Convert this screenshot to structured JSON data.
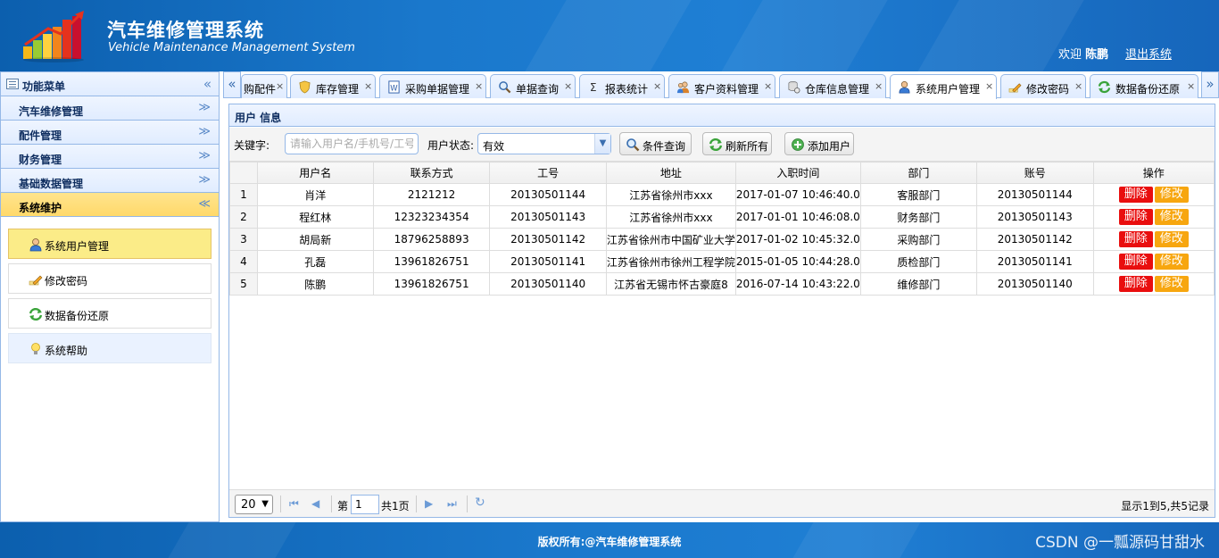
{
  "header": {
    "title": "汽车维修管理系统",
    "subtitle": "Vehicle Maintenance Management System",
    "welcome_prefix": "欢迎",
    "user_name": "陈鹏",
    "logout": "退出系统"
  },
  "sidebar": {
    "title": "功能菜单",
    "collapse_glyph": "«",
    "sections": [
      {
        "label": "汽车维修管理",
        "glyph": "≫"
      },
      {
        "label": "配件管理",
        "glyph": "≫"
      },
      {
        "label": "财务管理",
        "glyph": "≫"
      },
      {
        "label": "基础数据管理",
        "glyph": "≫"
      },
      {
        "label": "系统维护",
        "glyph": "≪"
      }
    ],
    "sub_items": [
      {
        "label": "系统用户管理",
        "icon": "user-icon"
      },
      {
        "label": "修改密码",
        "icon": "pencil-icon"
      },
      {
        "label": "数据备份还原",
        "icon": "refresh-icon"
      },
      {
        "label": "系统帮助",
        "icon": "lightbulb-icon"
      }
    ]
  },
  "tabs": {
    "scroll_left": "«",
    "scroll_right": "»",
    "close_glyph": "×",
    "items": [
      {
        "label": "购配件",
        "icon": "none"
      },
      {
        "label": "库存管理",
        "icon": "shield-icon"
      },
      {
        "label": "采购单据管理",
        "icon": "document-icon"
      },
      {
        "label": "单据查询",
        "icon": "search-icon"
      },
      {
        "label": "报表统计",
        "icon": "sigma-icon"
      },
      {
        "label": "客户资料管理",
        "icon": "users-icon"
      },
      {
        "label": "仓库信息管理",
        "icon": "database-icon"
      },
      {
        "label": "系统用户管理",
        "icon": "user-icon"
      },
      {
        "label": "修改密码",
        "icon": "pencil-icon"
      },
      {
        "label": "数据备份还原",
        "icon": "refresh-icon"
      }
    ]
  },
  "panel": {
    "title": "用户 信息",
    "keyword_label": "关键字:",
    "keyword_placeholder": "请输入用户名/手机号/工号",
    "status_label": "用户状态:",
    "status_value": "有效",
    "btn_query": "条件查询",
    "btn_refresh": "刷新所有",
    "btn_add": "添加用户"
  },
  "grid": {
    "columns": [
      "用户名",
      "联系方式",
      "工号",
      "地址",
      "入职时间",
      "部门",
      "账号",
      "操作"
    ],
    "delete_label": "删除",
    "edit_label": "修改",
    "rows": [
      {
        "n": "1",
        "name": "肖洋",
        "phone": "2121212",
        "no": "20130501144",
        "addr": "江苏省徐州市xxx",
        "time": "2017-01-07 10:46:40.0",
        "dept": "客服部门",
        "acct": "20130501144"
      },
      {
        "n": "2",
        "name": "程红林",
        "phone": "12323234354",
        "no": "20130501143",
        "addr": "江苏省徐州市xxx",
        "time": "2017-01-01 10:46:08.0",
        "dept": "财务部门",
        "acct": "20130501143"
      },
      {
        "n": "3",
        "name": "胡局新",
        "phone": "18796258893",
        "no": "20130501142",
        "addr": "江苏省徐州市中国矿业大学",
        "time": "2017-01-02 10:45:32.0",
        "dept": "采购部门",
        "acct": "20130501142"
      },
      {
        "n": "4",
        "name": "孔磊",
        "phone": "13961826751",
        "no": "20130501141",
        "addr": "江苏省徐州市徐州工程学院",
        "time": "2015-01-05 10:44:28.0",
        "dept": "质检部门",
        "acct": "20130501141"
      },
      {
        "n": "5",
        "name": "陈鹏",
        "phone": "13961826751",
        "no": "20130501140",
        "addr": "江苏省无锡市怀古豪庭8",
        "time": "2016-07-14 10:43:22.0",
        "dept": "维修部门",
        "acct": "20130501140"
      }
    ]
  },
  "pager": {
    "page_size": "20",
    "page_prefix": "第",
    "page_number": "1",
    "page_suffix": "共1页",
    "info": "显示1到5,共5记录",
    "first_glyph": "⏮",
    "prev_glyph": "◀",
    "next_glyph": "▶",
    "last_glyph": "⏭",
    "reload_glyph": "↻"
  },
  "footer": {
    "copyright": "版权所有:@汽车维修管理系统",
    "watermark": "CSDN @一瓢源码甘甜水"
  },
  "colors": {
    "header_blue": "#1a78cc",
    "border_blue": "#95b8e7",
    "active_menu": "#ffd96a",
    "delete_red": "#e90e0e",
    "edit_orange": "#f7a60f"
  }
}
